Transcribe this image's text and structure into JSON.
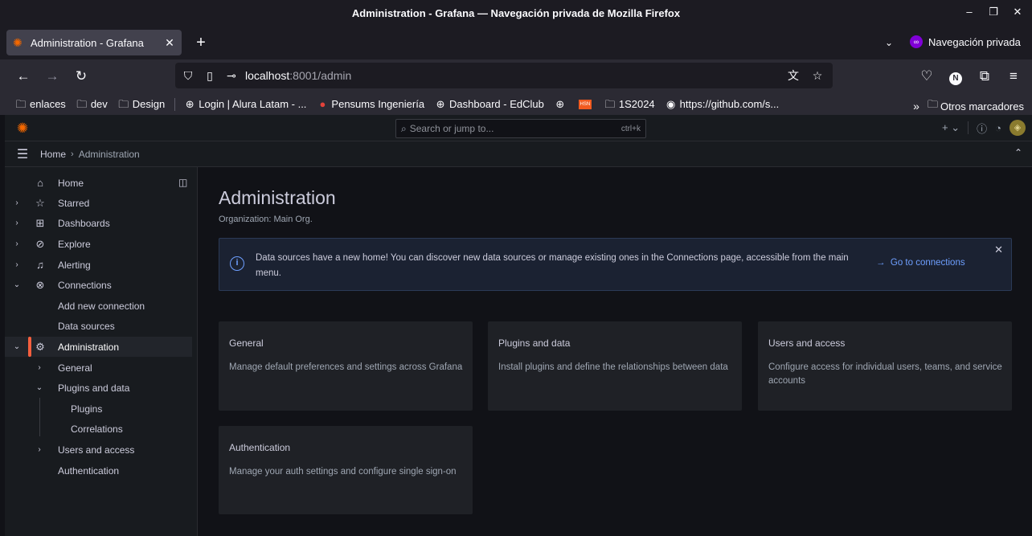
{
  "browser": {
    "window_title": "Administration - Grafana — Navegación privada de Mozilla Firefox",
    "tab_title": "Administration - Grafana",
    "private_label": "Navegación privada",
    "url_host": "localhost",
    "url_rest": ":8001/admin",
    "bookmarks": [
      "enlaces",
      "dev",
      "Design",
      "Login | Alura Latam - ...",
      "Pensums Ingeniería",
      "Dashboard - EdClub",
      "",
      "",
      "1S2024",
      "https://github.com/s..."
    ],
    "other_bookmarks": "Otros marcadores",
    "account_initial": "N"
  },
  "grafana": {
    "search_placeholder": "Search or jump to...",
    "search_shortcut": "ctrl+k",
    "breadcrumb": [
      "Home",
      "Administration"
    ],
    "sidebar": [
      {
        "label": "Home",
        "icon": "home-icon"
      },
      {
        "label": "Starred",
        "icon": "star-icon"
      },
      {
        "label": "Dashboards",
        "icon": "apps-icon"
      },
      {
        "label": "Explore",
        "icon": "compass-icon"
      },
      {
        "label": "Alerting",
        "icon": "bell-icon"
      },
      {
        "label": "Connections",
        "icon": "link-icon"
      },
      {
        "label": "Add new connection"
      },
      {
        "label": "Data sources"
      },
      {
        "label": "Administration",
        "icon": "cog-icon"
      },
      {
        "label": "General"
      },
      {
        "label": "Plugins and data"
      },
      {
        "label": "Plugins"
      },
      {
        "label": "Correlations"
      },
      {
        "label": "Users and access"
      },
      {
        "label": "Authentication"
      }
    ],
    "page_title": "Administration",
    "org_line": "Organization: Main Org.",
    "alert_text": "Data sources have a new home! You can discover new data sources or manage existing ones in the Connections page, accessible from the main menu.",
    "alert_link": "Go to connections",
    "cards": [
      {
        "title": "General",
        "desc": "Manage default preferences and settings across Grafana"
      },
      {
        "title": "Plugins and data",
        "desc": "Install plugins and define the relationships between data"
      },
      {
        "title": "Users and access",
        "desc": "Configure access for individual users, teams, and service accounts"
      },
      {
        "title": "Authentication",
        "desc": "Manage your auth settings and configure single sign-on"
      }
    ]
  }
}
